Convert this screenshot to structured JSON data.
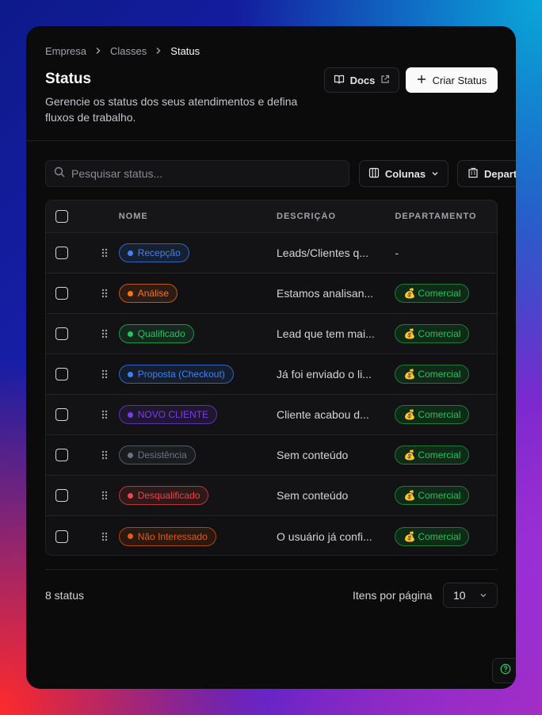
{
  "breadcrumb": [
    "Empresa",
    "Classes",
    "Status"
  ],
  "page": {
    "title": "Status",
    "subtitle": "Gerencie os status dos seus atendimentos e defina fluxos de trabalho."
  },
  "actions": {
    "docs_label": "Docs",
    "create_label": "Criar Status"
  },
  "toolbar": {
    "search_placeholder": "Pesquisar status...",
    "columns_label": "Colunas",
    "department_label": "Departamento"
  },
  "table": {
    "headers": {
      "name": "NOME",
      "description": "DESCRIÇÃO",
      "department": "DEPARTAMENTO"
    },
    "rows": [
      {
        "name": "Recepção",
        "color": "#3b82f6",
        "description": "Leads/Clientes q...",
        "department": "-"
      },
      {
        "name": "Análise",
        "color": "#f97316",
        "description": "Estamos analisan...",
        "department": "Comercial"
      },
      {
        "name": "Qualificado",
        "color": "#22c55e",
        "description": "Lead que tem mai...",
        "department": "Comercial"
      },
      {
        "name": "Proposta (Checkout)",
        "color": "#3b82f6",
        "description": "Já foi enviado o li...",
        "department": "Comercial"
      },
      {
        "name": "NOVO CLIENTE",
        "color": "#7c3aed",
        "description": "Cliente acabou d...",
        "department": "Comercial"
      },
      {
        "name": "Desistência",
        "color": "#6b7280",
        "description": "Sem conteúdo",
        "department": "Comercial"
      },
      {
        "name": "Desqualificado",
        "color": "#ef4444",
        "description": "Sem conteúdo",
        "department": "Comercial"
      },
      {
        "name": "Não Interessado",
        "color": "#ea580c",
        "description": "O usuário já confi...",
        "department": "Comercial"
      }
    ]
  },
  "footer": {
    "count": "8 status",
    "per_page_label": "Itens por página",
    "per_page_value": "10"
  },
  "icons": {
    "department": "money-bag-icon"
  }
}
